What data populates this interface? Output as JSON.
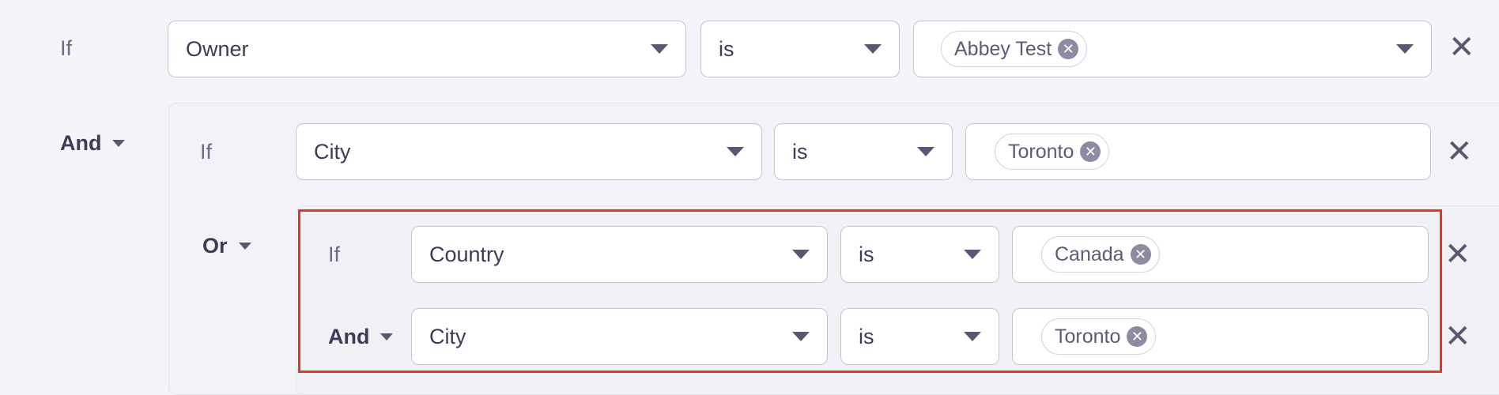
{
  "row1": {
    "label": "If",
    "field": "Owner",
    "operator": "is",
    "values": [
      "Abbey Test"
    ]
  },
  "group1": {
    "conjunction": "And",
    "row": {
      "label": "If",
      "field": "City",
      "operator": "is",
      "values": [
        "Toronto"
      ]
    },
    "subgroup": {
      "conjunction": "Or",
      "rows": [
        {
          "label": "If",
          "field": "Country",
          "operator": "is",
          "values": [
            "Canada"
          ]
        },
        {
          "conjunction": "And",
          "field": "City",
          "operator": "is",
          "values": [
            "Toronto"
          ]
        }
      ]
    }
  },
  "icons": {
    "dropdown": "caret-down-icon",
    "remove_chip": "circle-x-icon",
    "remove_row": "close-icon"
  },
  "colors": {
    "highlight_border": "#e03a26",
    "chip_remove_bg": "#8e8aa1"
  }
}
